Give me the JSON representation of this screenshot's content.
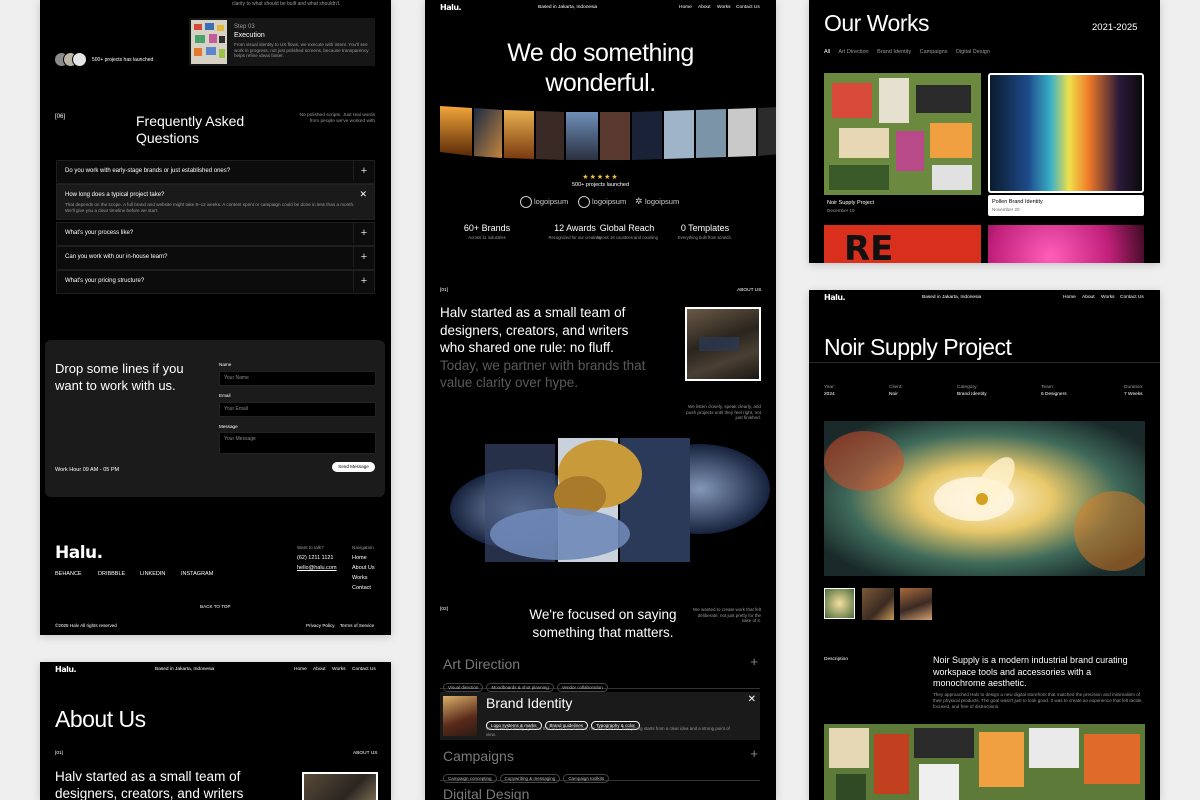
{
  "left_card": {
    "testimonial_fragment": "clarity to what should be built and what shouldn't.",
    "step_label": "Step 03",
    "step_title": "Execution",
    "step_desc": "From visual identity to UX flows, we execute with intent. You'll see work in progress, not just polished screens, because transparency helps refine ideas faster.",
    "projects_launched": "500+ projects has launched",
    "faq_tag": "[06]",
    "faq_title": "Frequently Asked Questions",
    "faq_side": "No polished scripts. Just real words from people we've worked with",
    "faq_items": [
      "Do you work with early-stage brands or just established ones?",
      "How long does a typical project take?",
      "What's your process like?",
      "Can you work with our in-house team?",
      "What's your pricing structure?"
    ],
    "faq_open_answer": "That depends on the scope. A full brand and website might take 8–12 weeks. A content sprint or campaign could be done in less than a month. We'll give you a clear timeline before we start.",
    "contact_title": "Drop some lines if you want to work with us.",
    "work_hour": "Work Hour 09 AM - 05 PM",
    "form_name_label": "Name",
    "form_name_placeholder": "Your Name",
    "form_email_label": "Email",
    "form_email_placeholder": "Your Email",
    "form_message_label": "Message",
    "form_message_placeholder": "Your Message",
    "send_button": "Send Message",
    "footer_logo": "Halu.",
    "socials": [
      "BEHANCE",
      "DRIBBBLE",
      "LINKEDIN",
      "INSTAGRAM"
    ],
    "want_to_talk": "Want to talk?",
    "phone": "(62) 1211 1121",
    "email": "hello@halu.com",
    "nav_heading": "Navigation",
    "nav_links": [
      "Home",
      "About Us",
      "Works",
      "Contact"
    ],
    "back_to_top": "BACK TO TOP",
    "copyright": "©2025 Halv All rights reserved",
    "privacy": "Privacy Policy",
    "terms": "Terms of Service"
  },
  "bottom_left": {
    "logo": "Halu.",
    "location": "Based in Jakarta, Indonesia",
    "nav": [
      "Home",
      "About",
      "Works",
      "Contact Us"
    ],
    "title": "About Us",
    "tag": "[01]",
    "about_label": "ABOUT US",
    "intro": "Halv started as a small team of designers, creators, and writers"
  },
  "center": {
    "logo": "Halu.",
    "location": "Based in Jakarta, Indonesia",
    "nav": [
      "Home",
      "About",
      "Works",
      "Contact Us"
    ],
    "hero_line1": "We do something",
    "hero_line2": "wonderful.",
    "stars": "★★★★★",
    "projects": "500+ projects launched",
    "logos": [
      "logoipsum",
      "logoipsum",
      "logoipsum"
    ],
    "stats": [
      {
        "value": "60+ Brands",
        "desc": "Across 11 industries"
      },
      {
        "value": "12 Awards",
        "desc": "Recognized for our creativity"
      },
      {
        "value": "Global Reach",
        "desc": "Across 16 countries and counting"
      },
      {
        "value": "0 Templates",
        "desc": "Everything built from scratch."
      }
    ],
    "tag01": "[01]",
    "about_label": "ABOUT US",
    "about_text_bright": "Halv started as a small team of designers, creators, and writers who shared one rule: no fluff.",
    "about_text_dim": "Today, we partner with brands that value clarity over hype.",
    "about_side": "We listen closely, speak clearly, and push projects until they feel right, not just finished.",
    "tag02": "[02]",
    "focus_title": "We're focused on saying something that matters.",
    "focus_side": "We wanted to create work that felt deliberate, not just pretty for the sake of it.",
    "services": [
      {
        "name": "Art Direction",
        "tags": [
          "Visual direction",
          "Moodboards & shot planning",
          "Vendor collaboration"
        ]
      },
      {
        "name": "Brand Identity",
        "tags": [
          "Logo systems & marks",
          "Brand guidelines",
          "Typography & color"
        ],
        "desc": "We develop identity systems that act as foundations, not decorations. Everything starts from a clear idea and a strong point of view."
      },
      {
        "name": "Campaigns",
        "tags": [
          "Campaign concepting",
          "Copywriting & messaging",
          "Campaign toolkits"
        ]
      },
      {
        "name": "Digital Design",
        "tags": []
      }
    ]
  },
  "top_right": {
    "title": "Our Works",
    "years": "2021-2025",
    "filters": [
      "All",
      "Art Direction",
      "Brand Identity",
      "Campaigns",
      "Digital Design"
    ],
    "projects": [
      {
        "name": "Noir Supply Project",
        "date": "December 19"
      },
      {
        "name": "Pollen Brand Identity",
        "date": "November 20"
      }
    ]
  },
  "bottom_right": {
    "logo": "Halu.",
    "location": "Based in Jakarta, Indonesia",
    "nav": [
      "Home",
      "About",
      "Works",
      "Contact Us"
    ],
    "title": "Noir Supply Project",
    "meta": [
      {
        "label": "Year:",
        "value": "2024"
      },
      {
        "label": "Client:",
        "value": "Noir"
      },
      {
        "label": "Category:",
        "value": "Brand Identity"
      },
      {
        "label": "Team:",
        "value": "6 Designers"
      },
      {
        "label": "Duration:",
        "value": "7 Weeks"
      }
    ],
    "desc_label": "Description",
    "desc_lead": "Noir Supply is a modern industrial brand curating workspace tools and accessories with a monochrome aesthetic.",
    "desc_body": "They approached Halv to design a new digital storefront that matched the precision and minimalism of their physical products. The goal wasn't just to look good. It was to create an experience that felt tactile, focused, and free of distractions."
  }
}
